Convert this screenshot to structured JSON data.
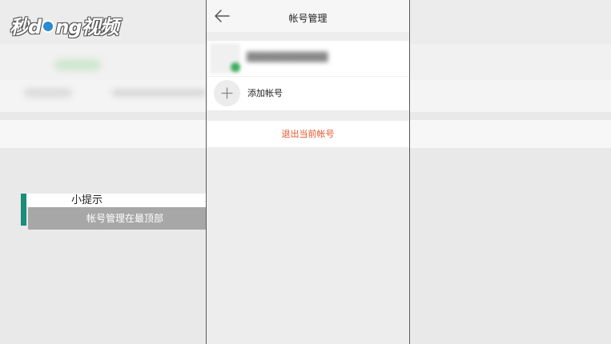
{
  "watermark": {
    "logo_text_pre": "秒",
    "logo_text_mid": "d",
    "logo_text_post": "ng视频"
  },
  "tip": {
    "title": "小提示",
    "body": "帐号管理在最顶部"
  },
  "screen": {
    "nav_title": "帐号管理",
    "add_account_label": "添加帐号",
    "logout_label": "退出当前帐号"
  },
  "icons": {
    "back": "back-arrow-icon",
    "add": "plus-icon"
  },
  "colors": {
    "logout_text": "#e8552a",
    "tip_accent": "#1a8d7c",
    "avatar_dot": "#3dae5c"
  }
}
